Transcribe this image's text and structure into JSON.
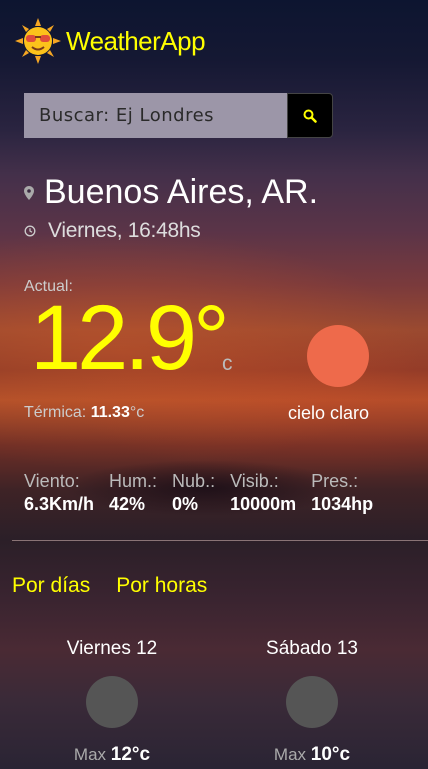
{
  "app": {
    "name": "WeatherApp",
    "logo_icon": "sun-with-sunglasses-icon",
    "accent": "#ffff00"
  },
  "search": {
    "placeholder": "Buscar: Ej Londres",
    "value": "",
    "button_icon": "search-icon"
  },
  "location": {
    "city": "Buenos Aires, AR.",
    "datetime": "Viernes, 16:48hs",
    "pin_icon": "location-pin-icon",
    "clock_icon": "clock-icon"
  },
  "current": {
    "label": "Actual:",
    "temp": "12.9°",
    "unit": "c",
    "feels_label": "Térmica:",
    "feels_value": "11.33",
    "feels_unit": "°c",
    "description": "cielo claro",
    "icon": "sun-icon",
    "icon_color": "#ee6a4b"
  },
  "stats": [
    {
      "label": "Viento:",
      "value": "6.3Km/h"
    },
    {
      "label": "Hum.:",
      "value": "42%"
    },
    {
      "label": "Nub.:",
      "value": "0%"
    },
    {
      "label": "Visib.:",
      "value": "10000m"
    },
    {
      "label": "Pres.:",
      "value": "1034hp"
    }
  ],
  "tabs": [
    {
      "label": "Por días"
    },
    {
      "label": "Por horas"
    }
  ],
  "forecast": [
    {
      "day": "Viernes 12",
      "max_label": "Max",
      "max_value": "12°c"
    },
    {
      "day": "Sábado 13",
      "max_label": "Max",
      "max_value": "10°c"
    }
  ]
}
